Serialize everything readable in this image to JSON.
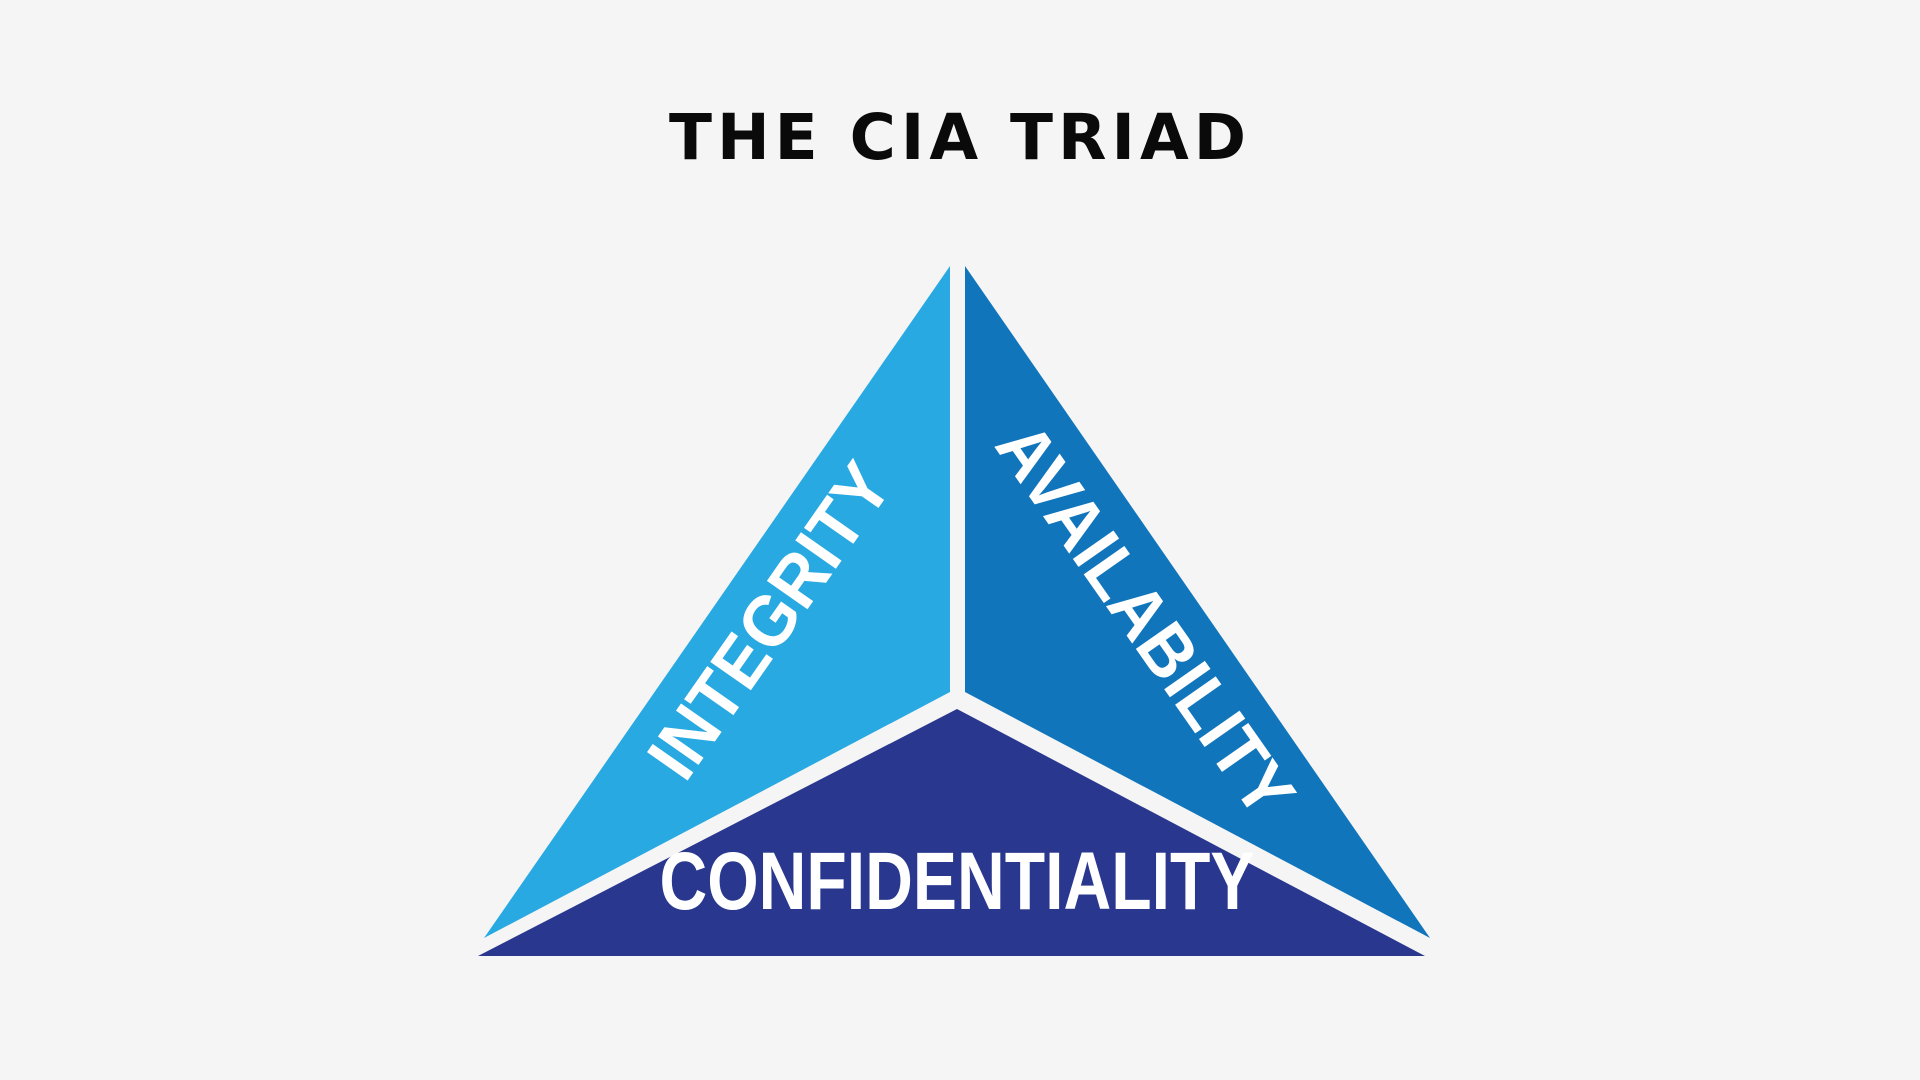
{
  "title": "THE CIA TRIAD",
  "segments": {
    "integrity": {
      "label": "INTEGRITY",
      "color": "#29a9e1"
    },
    "availability": {
      "label": "AVAILABILITY",
      "color": "#1175bc"
    },
    "confidentiality": {
      "label": "CONFIDENTIALITY",
      "color": "#29378f"
    }
  },
  "colors": {
    "background": "#f5f5f5",
    "title": "#0a0a0a",
    "label": "#ffffff"
  }
}
